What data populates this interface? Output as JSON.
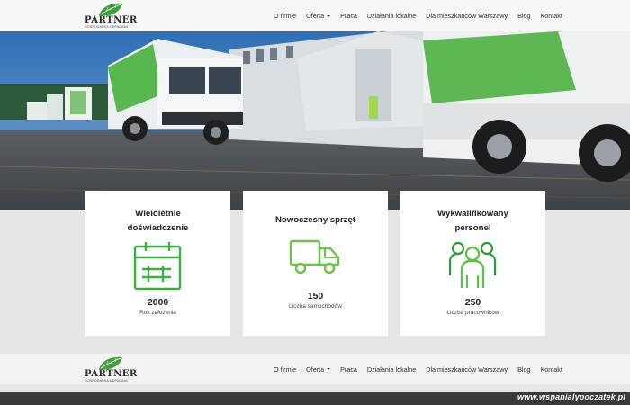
{
  "header": {
    "logo_text": "PARTNER",
    "logo_subtitle": "GOSPODARKA ODPADAMI",
    "menu": [
      {
        "label": "O firmie"
      },
      {
        "label": "Oferta"
      },
      {
        "label": "Praca"
      },
      {
        "label": "Działania lokalne"
      },
      {
        "label": "Dla mieszkańców Warszawy"
      },
      {
        "label": "Blog"
      },
      {
        "label": "Kontakt"
      }
    ]
  },
  "features": [
    {
      "title_line1": "Wieloletnie",
      "title_line2": "doświadczenie",
      "icon": "calendar-icon",
      "value": "2000",
      "label": "Rok założenia"
    },
    {
      "title_line1": "Nowoczesny sprzęt",
      "title_line2": "",
      "icon": "truck-icon",
      "value": "150",
      "label": "Liczba samochodów"
    },
    {
      "title_line1": "Wykwalifikowany",
      "title_line2": "personel",
      "icon": "people-icon",
      "value": "250",
      "label": "Liczba pracowników"
    }
  ],
  "sticky_header": {
    "logo_text": "PARTNER",
    "logo_subtitle": "GOSPODARKA ODPADAMI",
    "menu": [
      {
        "label": "O firmie"
      },
      {
        "label": "Oferta"
      },
      {
        "label": "Praca"
      },
      {
        "label": "Działania lokalne"
      },
      {
        "label": "Dla mieszkańców Warszawy"
      },
      {
        "label": "Blog"
      },
      {
        "label": "Kontakt"
      }
    ]
  },
  "watermark": "www.wspanialypoczatek.pl",
  "colors": {
    "accent_green": "#4caf3a",
    "icon_green": "#3cb043",
    "leaf_green": "#3f9f3a"
  }
}
